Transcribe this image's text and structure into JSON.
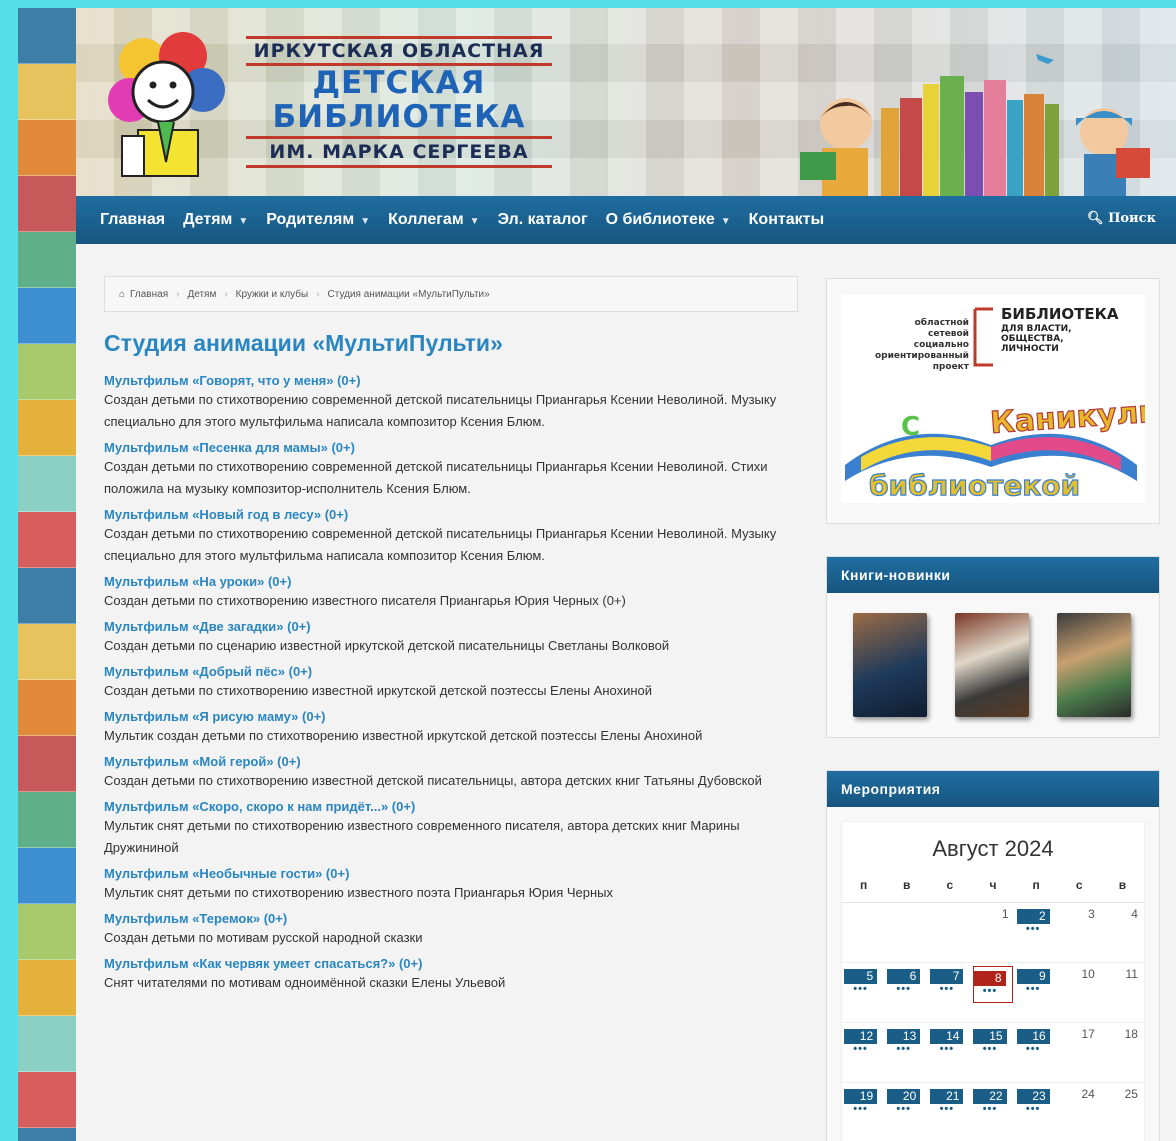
{
  "colors": {
    "nav": "#1f6ea1",
    "accent_link": "#2a86c0",
    "today": "#b1241b",
    "event": "#1a5d86",
    "mosaic": [
      "#3d7fa8",
      "#e6c35c",
      "#e08a3a",
      "#c65a5a",
      "#5fb08a",
      "#3d8fd1",
      "#a8c96a",
      "#e4b23a",
      "#8bd0c2",
      "#d85d5d"
    ]
  },
  "header": {
    "line1": "ИРКУТСКАЯ ОБЛАСТНАЯ",
    "line2": "ДЕТСКАЯ",
    "line3": "БИБЛИОТЕКА",
    "line4": "ИМ. МАРКА СЕРГЕЕВА"
  },
  "nav": {
    "items": [
      {
        "label": "Главная",
        "dropdown": false
      },
      {
        "label": "Детям",
        "dropdown": true
      },
      {
        "label": "Родителям",
        "dropdown": true
      },
      {
        "label": "Коллегам",
        "dropdown": true
      },
      {
        "label": "Эл. каталог",
        "dropdown": false
      },
      {
        "label": "О библиотеке",
        "dropdown": true
      },
      {
        "label": "Контакты",
        "dropdown": false
      }
    ],
    "search_label": "Поиск"
  },
  "breadcrumb": [
    "Главная",
    "Детям",
    "Кружки и клубы",
    "Студия анимации «МультиПульти»"
  ],
  "page_title": "Студия анимации «МультиПульти»",
  "films": [
    {
      "title": "Мультфильм «Говорят, что у меня» (0+)",
      "desc": "Создан детьми по стихотворению современной детской писательницы Приангарья Ксении Неволиной. Музыку специально для этого мультфильма написала композитор Ксения Блюм."
    },
    {
      "title": "Мультфильм «Песенка для мамы» (0+)",
      "desc": "Создан детьми по стихотворению современной детской писательницы Приангарья Ксении Неволиной. Стихи положила на музыку композитор-исполнитель Ксения Блюм."
    },
    {
      "title": "Мультфильм «Новый год в лесу» (0+)",
      "desc": "Создан детьми по стихотворению современной детской писательницы Приангарья Ксении Неволиной. Музыку специально для этого мультфильма написала композитор Ксения Блюм."
    },
    {
      "title": "Мультфильм «На уроки» (0+)",
      "desc": "Создан детьми по стихотворению известного писателя Приангарья Юрия Черных (0+)"
    },
    {
      "title": "Мультфильм «Две загадки» (0+)",
      "desc": "Создан детьми по сценарию известной иркутской детской писательницы Светланы Волковой"
    },
    {
      "title": "Мультфильм «Добрый пёс» (0+)",
      "desc": "Создан детьми по стихотворению известной иркутской детской поэтессы Елены Анохиной"
    },
    {
      "title": "Мультфильм «Я рисую маму» (0+)",
      "desc": "Мультик создан детьми по стихотворению известной иркутской детской поэтессы Елены Анохиной"
    },
    {
      "title": "Мультфильм «Мой герой» (0+)",
      "desc": "Создан детьми по стихотворению известной детской писательницы, автора детских книг Татьяны Дубовской"
    },
    {
      "title": "Мультфильм «Скоро, скоро к нам придёт...» (0+)",
      "desc": "Мультик снят детьми по стихотворению известного современного писателя, автора детских книг Марины Дружининой"
    },
    {
      "title": "Мультфильм «Необычные гости» (0+)",
      "desc": "Мультик снят детьми по стихотворению известного поэта Приангарья Юрия Черных"
    },
    {
      "title": "Мультфильм «Теремок» (0+)",
      "desc": "Создан детьми по мотивам русской народной сказки"
    },
    {
      "title": "Мультфильм «Как червяк умеет спасаться?» (0+)",
      "desc": "Снят читателями по мотивам одноимённой сказки Елены Ульевой"
    }
  ],
  "promo": {
    "left_text": "областной сетевой социально ориентированный проект",
    "right_title": "БИБЛИОТЕКА",
    "right_sub": "ДЛЯ ВЛАСТИ, ОБЩЕСТВА, ЛИЧНОСТИ",
    "banner_word1": "Каникулы",
    "banner_word2": "с",
    "banner_word3": "библиотекой"
  },
  "books_widget": {
    "title": "Книги-новинки"
  },
  "events_widget": {
    "title": "Мероприятия",
    "month": "Август 2024",
    "weekdays": [
      "п",
      "в",
      "с",
      "ч",
      "п",
      "с",
      "в"
    ],
    "weeks": [
      [
        null,
        null,
        null,
        {
          "d": "1"
        },
        {
          "d": "2",
          "ev": true
        },
        {
          "d": "3"
        },
        {
          "d": "4"
        }
      ],
      [
        {
          "d": "5",
          "ev": true
        },
        {
          "d": "6",
          "ev": true
        },
        {
          "d": "7",
          "ev": true
        },
        {
          "d": "8",
          "ev": true,
          "today": true
        },
        {
          "d": "9",
          "ev": true
        },
        {
          "d": "10"
        },
        {
          "d": "11"
        }
      ],
      [
        {
          "d": "12",
          "ev": true
        },
        {
          "d": "13",
          "ev": true
        },
        {
          "d": "14",
          "ev": true
        },
        {
          "d": "15",
          "ev": true
        },
        {
          "d": "16",
          "ev": true
        },
        {
          "d": "17"
        },
        {
          "d": "18"
        }
      ],
      [
        {
          "d": "19",
          "ev": true
        },
        {
          "d": "20",
          "ev": true
        },
        {
          "d": "21",
          "ev": true
        },
        {
          "d": "22",
          "ev": true
        },
        {
          "d": "23",
          "ev": true
        },
        {
          "d": "24"
        },
        {
          "d": "25"
        }
      ]
    ]
  }
}
